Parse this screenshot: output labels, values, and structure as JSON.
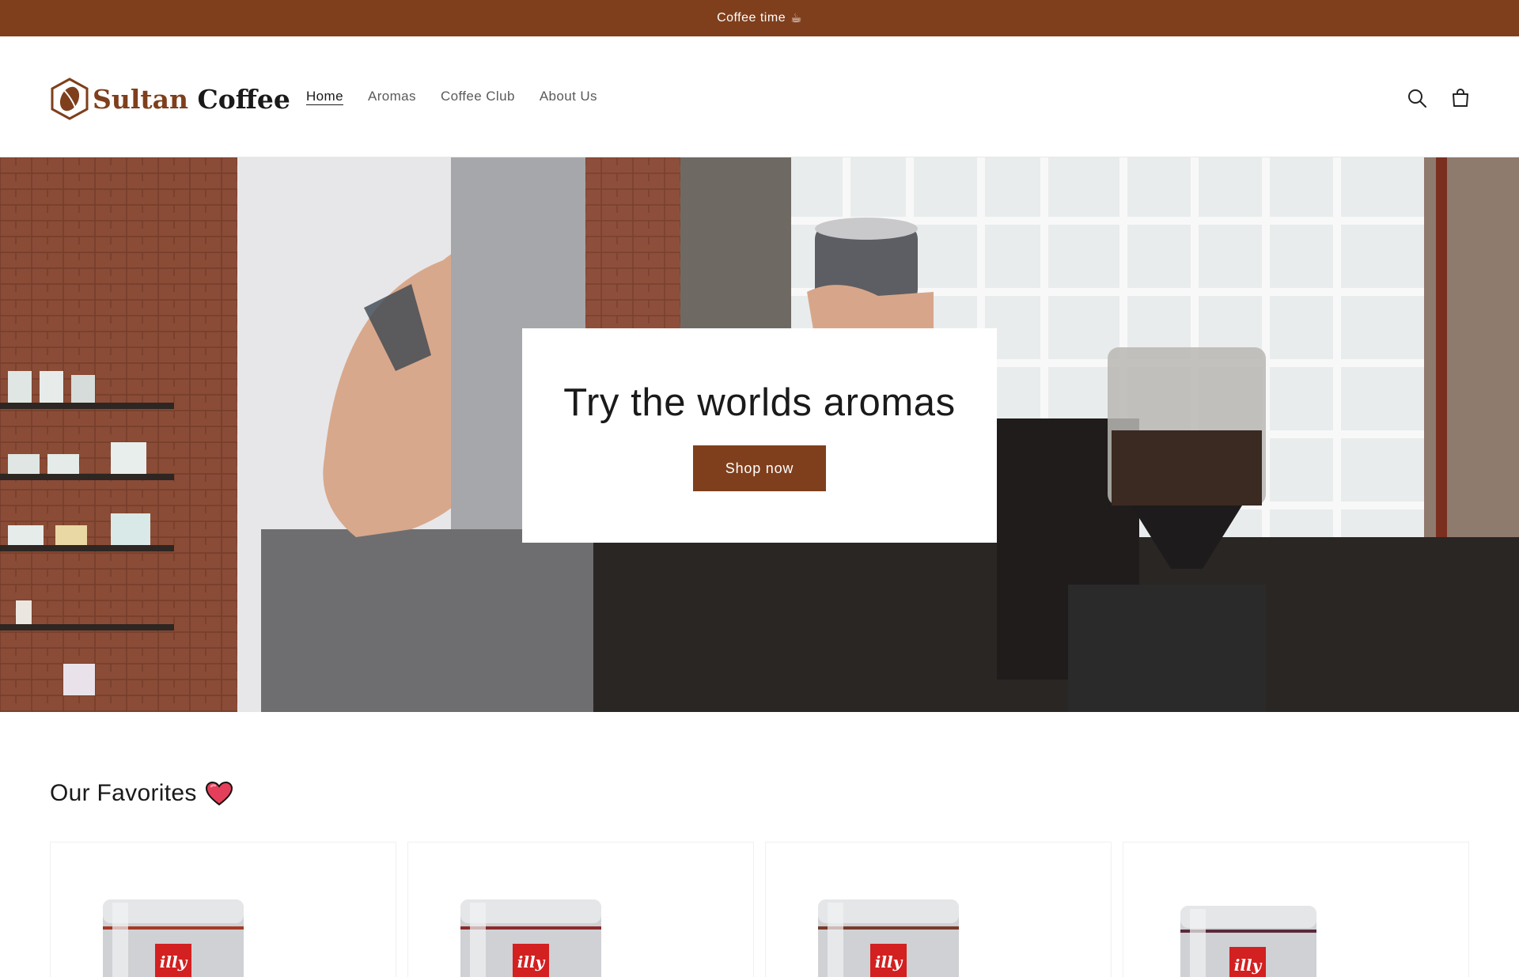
{
  "announcement": {
    "text": "Coffee time",
    "icon": "coffee-cup-icon"
  },
  "header": {
    "logo": {
      "word1": "Sultan",
      "word2": "Coffee",
      "icon": "coffee-bean-icon"
    },
    "nav": [
      {
        "label": "Home",
        "active": true
      },
      {
        "label": "Aromas",
        "active": false
      },
      {
        "label": "Coffee Club",
        "active": false
      },
      {
        "label": "About Us",
        "active": false
      }
    ],
    "icons": [
      "search-icon",
      "cart-icon"
    ]
  },
  "hero": {
    "title": "Try the worlds aromas",
    "button_label": "Shop now"
  },
  "favorites": {
    "title": "Our Favorites",
    "icon": "heart-icon",
    "products": [
      {
        "brand": "illy",
        "image": "illy-coffee-can"
      },
      {
        "brand": "illy",
        "image": "illy-coffee-can"
      },
      {
        "brand": "illy",
        "image": "illy-coffee-can"
      },
      {
        "brand": "illy",
        "image": "illy-coffee-can"
      }
    ]
  },
  "colors": {
    "accent": "#7f3f1c",
    "text": "#121212",
    "muted": "#5a5a5a"
  }
}
